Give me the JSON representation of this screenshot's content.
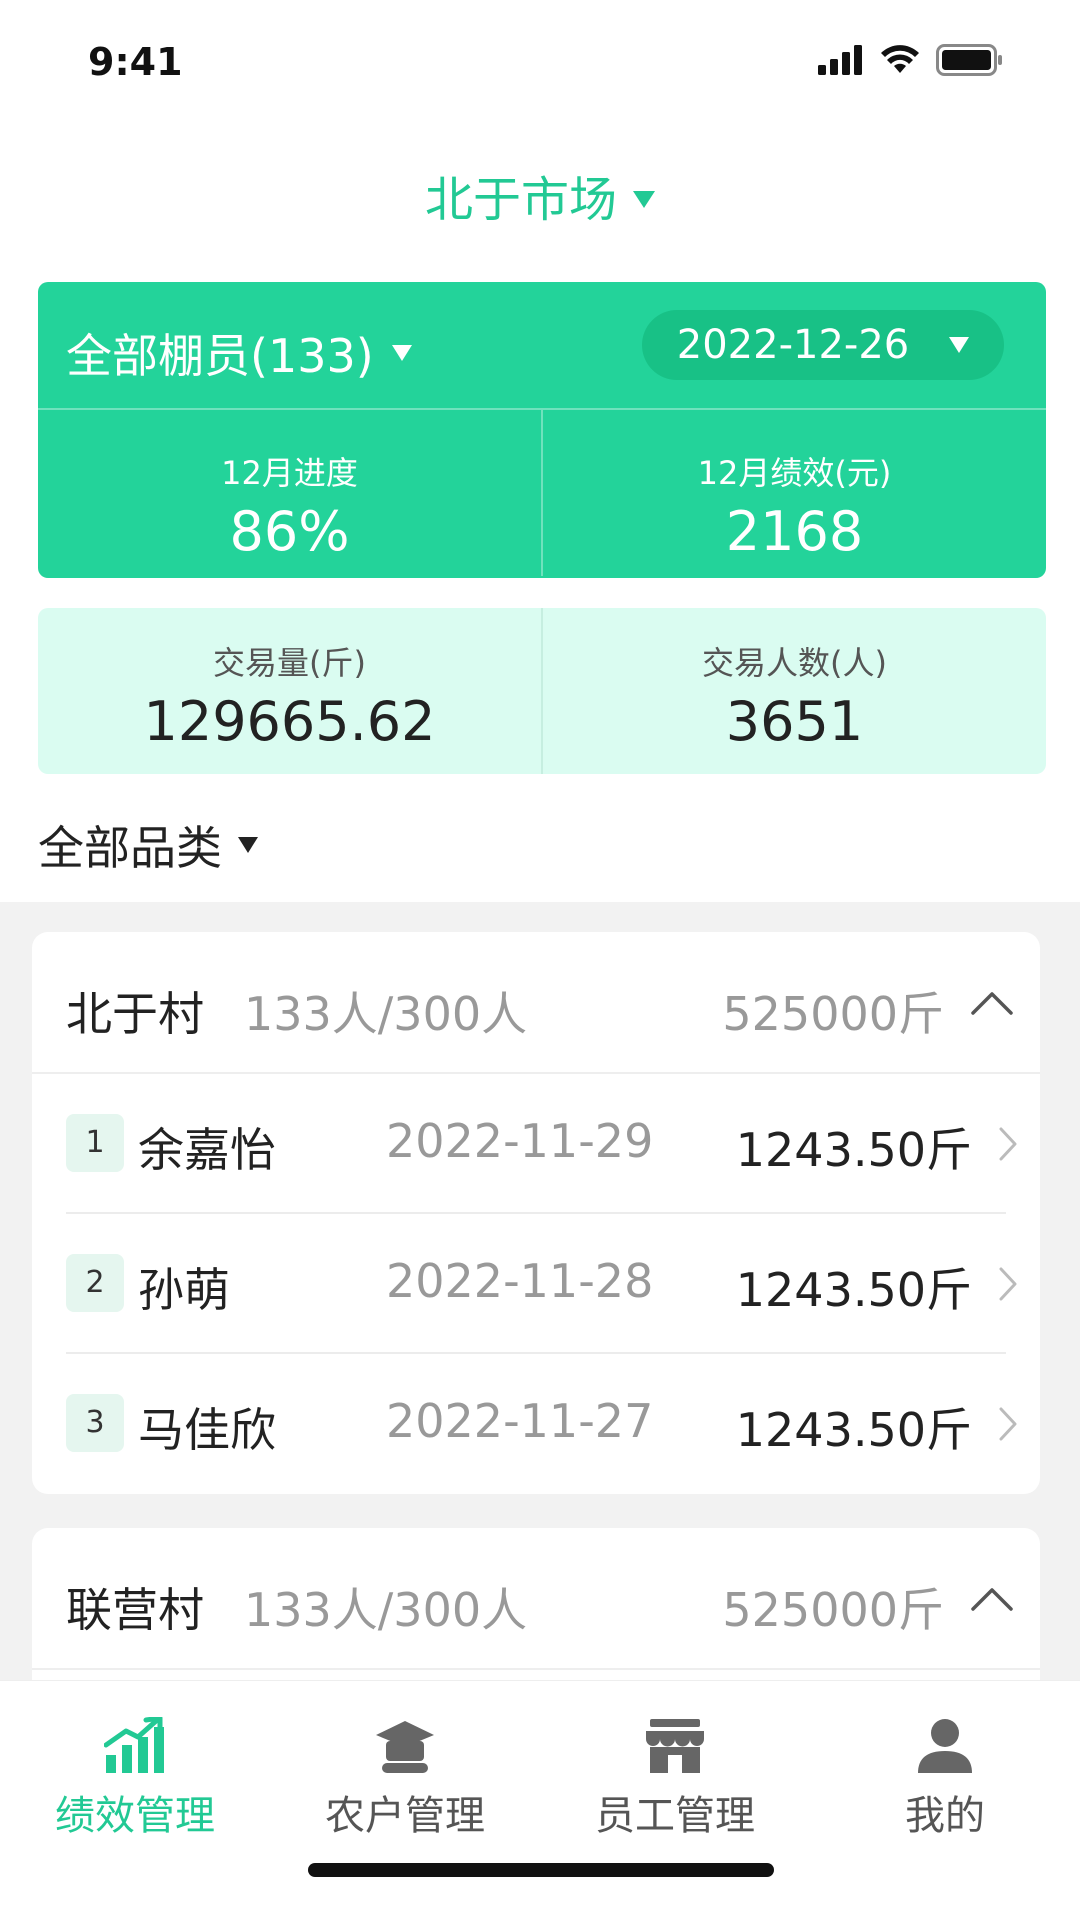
{
  "status": {
    "time": "9:41"
  },
  "market": {
    "title": "北于市场"
  },
  "summary": {
    "members_label": "全部棚员(133)",
    "date": "2022-12-26",
    "progress_label": "12月进度",
    "progress_value": "86%",
    "performance_label": "12月绩效(元)",
    "performance_value": "2168"
  },
  "stats": {
    "volume_label": "交易量(斤)",
    "volume_value": "129665.62",
    "people_label": "交易人数(人)",
    "people_value": "3651"
  },
  "category": {
    "label": "全部品类"
  },
  "villages": [
    {
      "name": "北于村",
      "count": "133人/300人",
      "total": "525000斤",
      "rows": [
        {
          "rank": "1",
          "name": "余嘉怡",
          "date": "2022-11-29",
          "weight": "1243.50斤"
        },
        {
          "rank": "2",
          "name": "孙萌",
          "date": "2022-11-28",
          "weight": "1243.50斤"
        },
        {
          "rank": "3",
          "name": "马佳欣",
          "date": "2022-11-27",
          "weight": "1243.50斤"
        }
      ]
    },
    {
      "name": "联营村",
      "count": "133人/300人",
      "total": "525000斤",
      "rows": []
    }
  ],
  "tabs": [
    {
      "label": "绩效管理",
      "icon": "chart-icon",
      "active": true
    },
    {
      "label": "农户管理",
      "icon": "farmer-icon",
      "active": false
    },
    {
      "label": "员工管理",
      "icon": "store-icon",
      "active": false
    },
    {
      "label": "我的",
      "icon": "person-icon",
      "active": false
    }
  ],
  "colors": {
    "accent": "#23d39a",
    "light": "#dafcf1",
    "muted": "#999999"
  }
}
